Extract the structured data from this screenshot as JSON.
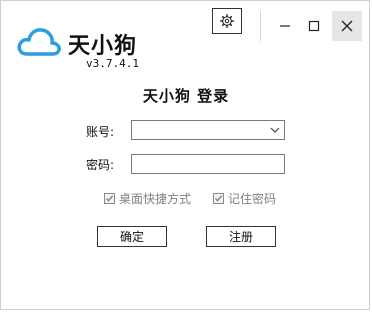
{
  "brand": {
    "name": "天小狗",
    "version": "v3.7.4.1",
    "logo_color": "#2a9fe0"
  },
  "titlebar": {
    "settings_icon": "gear-icon",
    "minimize_icon": "minimize-icon",
    "maximize_icon": "maximize-icon",
    "close_icon": "close-icon"
  },
  "form": {
    "title": "天小狗  登录",
    "account_label": "账号:",
    "account_value": "",
    "password_label": "密码:",
    "password_value": "",
    "options": [
      {
        "label": "桌面快捷方式",
        "checked": true,
        "enabled": false
      },
      {
        "label": "记住密码",
        "checked": true,
        "enabled": false
      }
    ],
    "confirm_label": "确定",
    "register_label": "注册"
  }
}
